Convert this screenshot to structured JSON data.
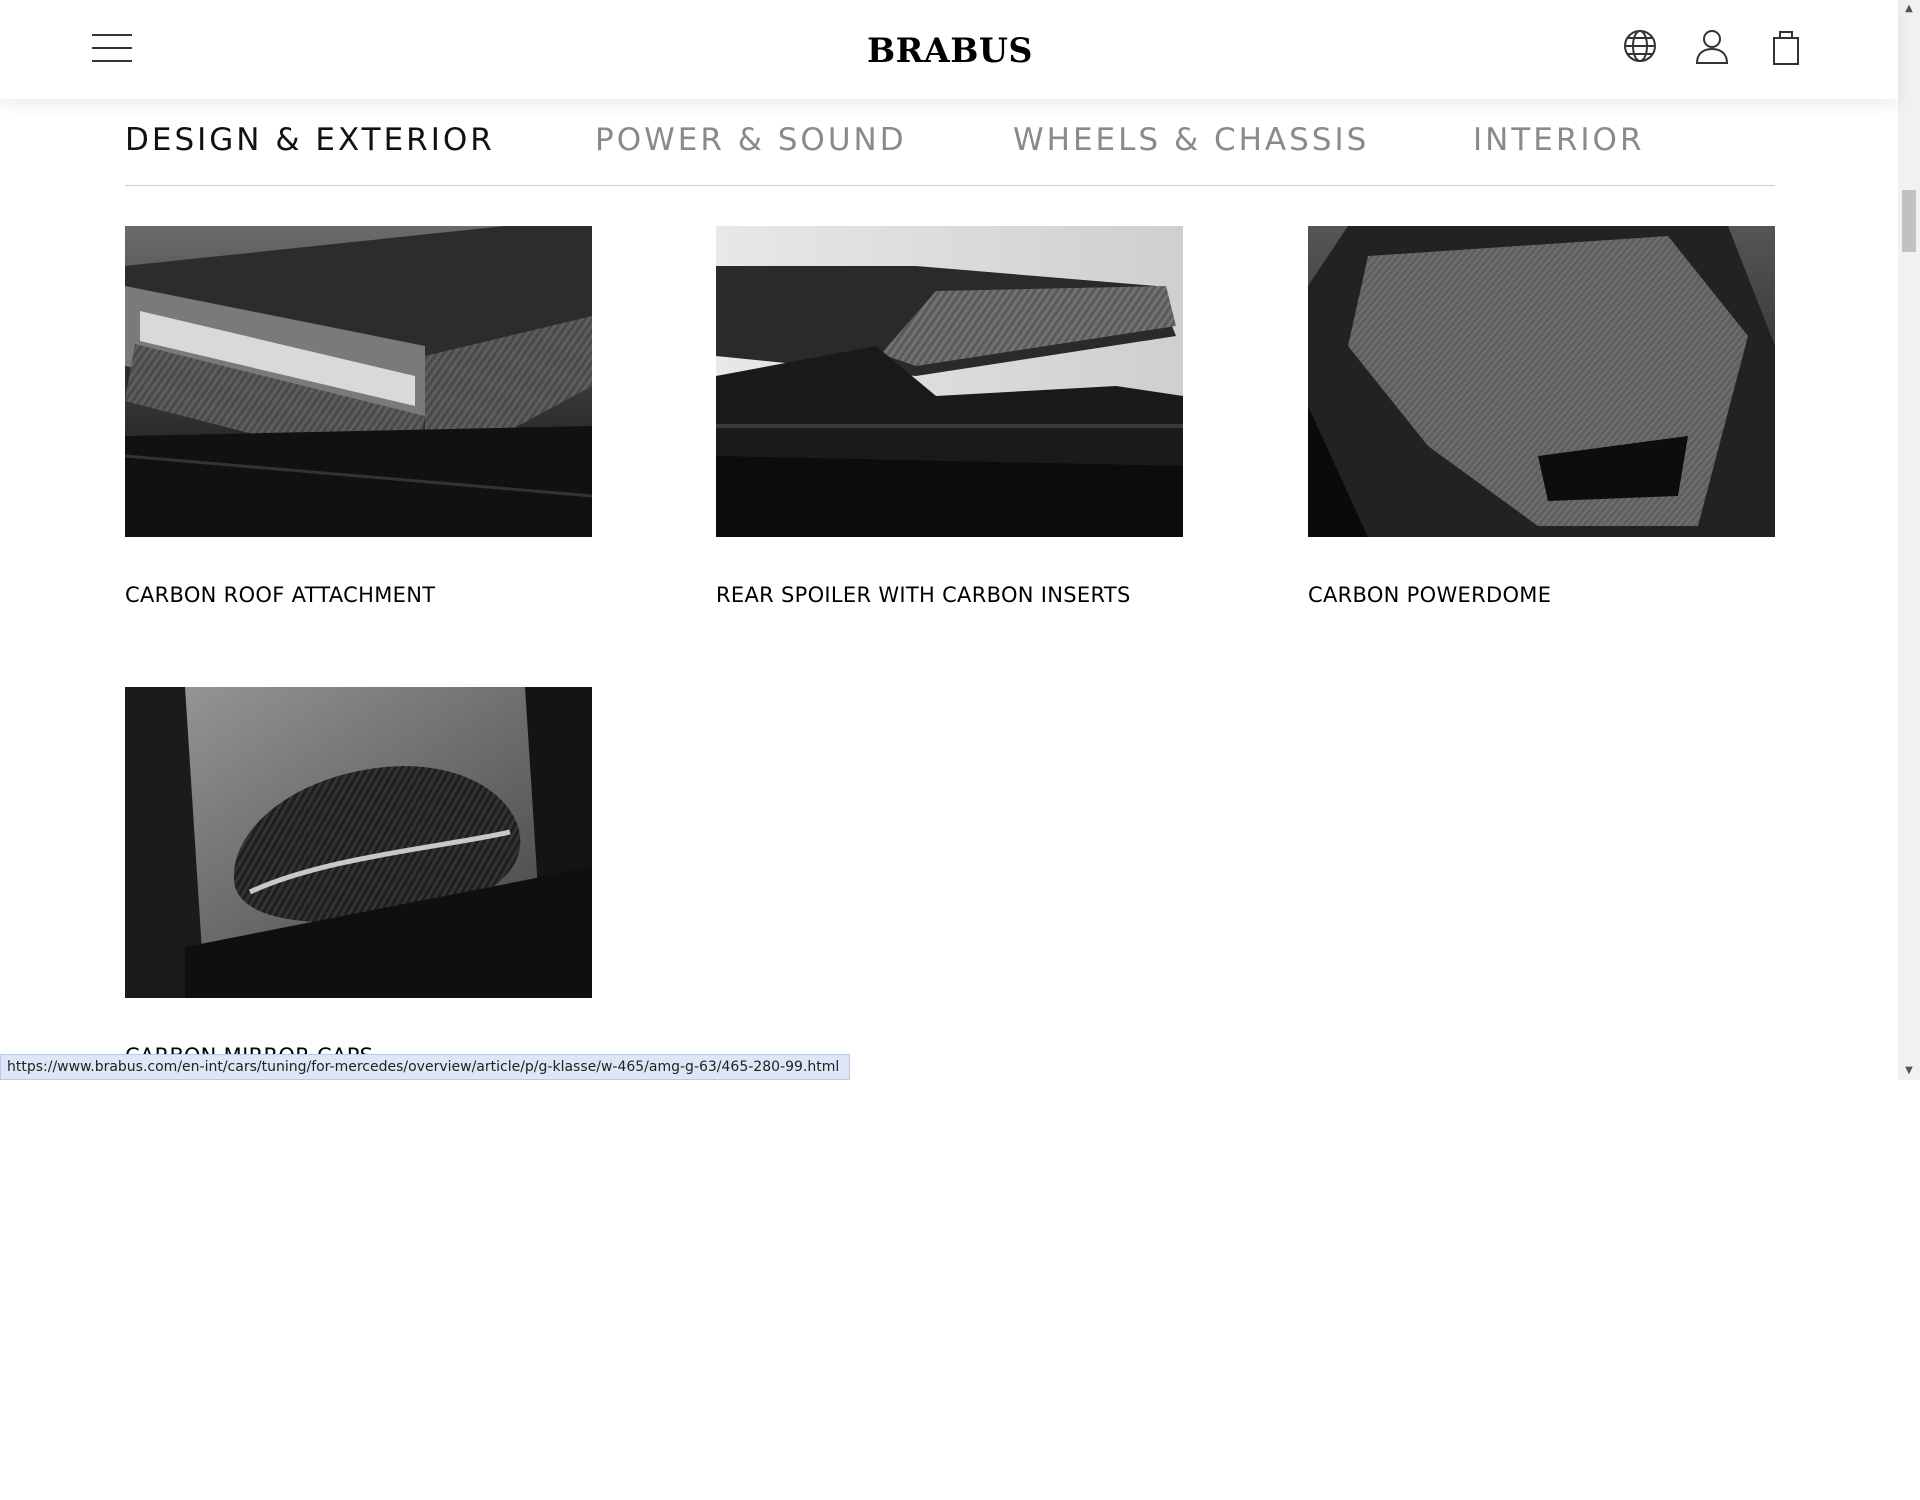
{
  "header": {
    "logo": "BRABUS",
    "menu_icon": "hamburger-menu-icon",
    "language_icon": "globe-icon",
    "account_icon": "user-icon",
    "cart_icon": "shopping-bag-icon"
  },
  "tabs": [
    {
      "label": "DESIGN & EXTERIOR",
      "active": true
    },
    {
      "label": "POWER & SOUND",
      "active": false
    },
    {
      "label": "WHEELS & CHASSIS",
      "active": false
    },
    {
      "label": "INTERIOR",
      "active": false
    }
  ],
  "products": [
    {
      "title": "CARBON ROOF ATTACHMENT"
    },
    {
      "title": "REAR SPOILER WITH CARBON INSERTS"
    },
    {
      "title": "CARBON POWERDOME"
    },
    {
      "title": "CARBON MIRROR CAPS"
    }
  ],
  "status_url": "https://www.brabus.com/en-int/cars/tuning/for-mercedes/overview/article/p/g-klasse/w-465/amg-g-63/465-280-99.html",
  "colors": {
    "accent": "#000000",
    "inactive_tab": "#8a8a8a",
    "status_bg": "#dde7f7"
  }
}
